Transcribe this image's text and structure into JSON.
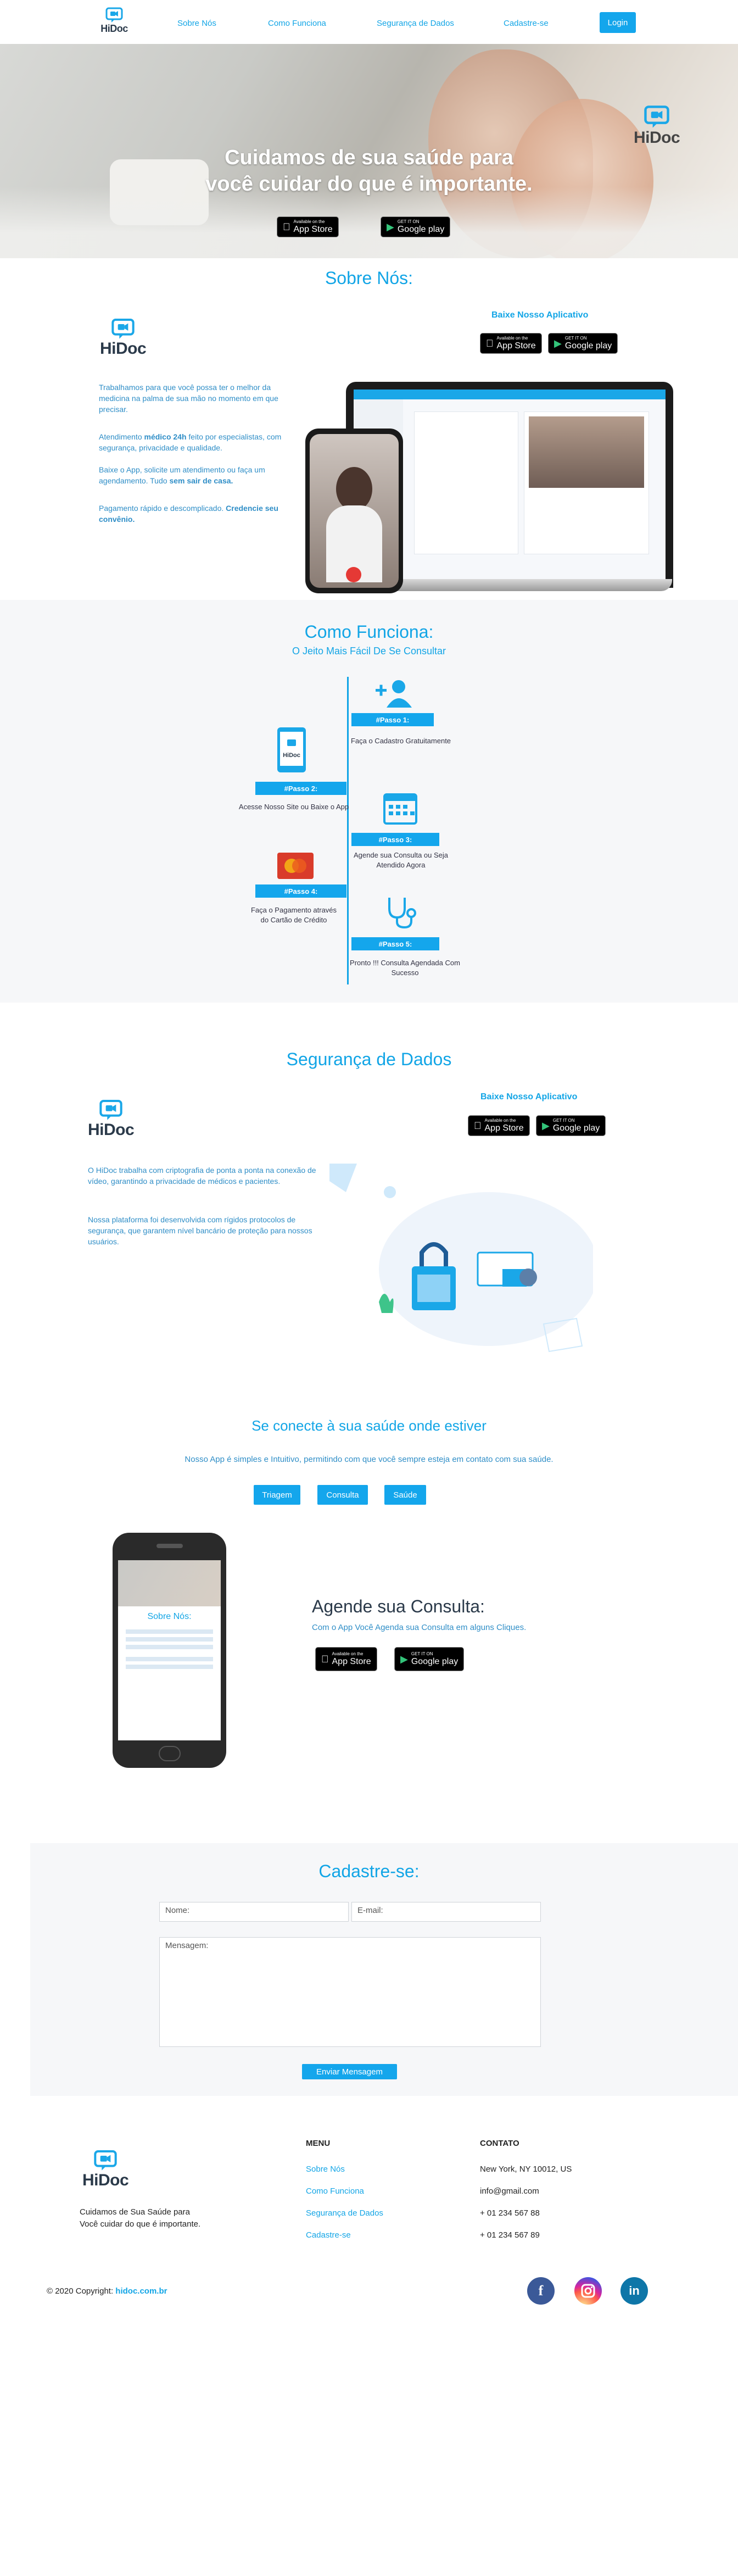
{
  "nav": {
    "logo": "HiDoc",
    "links": [
      "Sobre Nós",
      "Como Funciona",
      "Segurança de Dados",
      "Cadastre-se"
    ],
    "login": "Login"
  },
  "hero": {
    "title_line1": "Cuidamos de sua saúde para",
    "title_line2": "você cuidar do que é importante.",
    "logo": "HiDoc",
    "appstore_small": "Available on the",
    "appstore_big": "App Store",
    "googleplay_small": "GET IT ON",
    "googleplay_big": "Google play"
  },
  "sobre": {
    "title": "Sobre Nós:",
    "download_title": "Baixe Nosso Aplicativo",
    "logo": "HiDoc",
    "p1": "Trabalhamos para que você possa ter o melhor da medicina na palma de sua mão no momento em que precisar.",
    "p2_pre": "Atendimento ",
    "p2_bold": "médico 24h",
    "p2_post": " feito por especialistas, com segurança, privacidade e qualidade.",
    "p3_pre": "Baixe o App, solicite um atendimento ou faça um agendamento. Tudo ",
    "p3_bold": "sem sair de casa.",
    "p4_pre": "Pagamento rápido e descomplicado. ",
    "p4_bold": "Credencie seu convênio."
  },
  "como": {
    "title": "Como Funciona:",
    "subtitle": "O Jeito Mais Fácil De Se Consultar",
    "steps": [
      {
        "label": "#Passo 1:",
        "text": "Faça o Cadastro Gratuitamente",
        "icon": "add-user-icon"
      },
      {
        "label": "#Passo 2:",
        "text": "Acesse Nosso Site ou Baixe o App",
        "icon": "smartphone-icon"
      },
      {
        "label": "#Passo 3:",
        "text": "Agende sua Consulta ou Seja Atendido Agora",
        "icon": "calendar-icon"
      },
      {
        "label": "#Passo 4:",
        "text": "Faça o Pagamento através do Cartão de Crédito",
        "icon": "credit-card-icon"
      },
      {
        "label": "#Passo 5:",
        "text": "Pronto !!! Consulta Agendada Com Sucesso",
        "icon": "stethoscope-icon"
      }
    ]
  },
  "seguranca": {
    "title": "Segurança de Dados",
    "download_title": "Baixe Nosso Aplicativo",
    "logo": "HiDoc",
    "p1": "O HiDoc trabalha com criptografia de ponta a ponta na conexão de vídeo, garantindo a privacidade de médicos e pacientes.",
    "p2": "Nossa plataforma foi desenvolvida com rígidos protocolos de segurança, que garantem nível bancário de proteção para nossos usuários."
  },
  "conecte": {
    "title": "Se conecte à sua saúde onde estiver",
    "subtitle": "Nosso App é simples e Intuitivo, permitindo com que você sempre esteja em contato com sua saúde.",
    "tabs": [
      "Triagem",
      "Consulta",
      "Saúde"
    ],
    "agende_title": "Agende sua Consulta:",
    "agende_text": "Com o App Você Agenda sua Consulta em alguns Cliques.",
    "phone_title": "Sobre Nós:"
  },
  "cadastro": {
    "title": "Cadastre-se:",
    "name_placeholder": "Nome:",
    "email_placeholder": "E-mail:",
    "message_placeholder": "Mensagem:",
    "send": "Enviar Mensagem"
  },
  "footer": {
    "logo": "HiDoc",
    "tagline1": "Cuidamos de Sua Saúde para",
    "tagline2": "Você cuidar do que é importante.",
    "menu_title": "MENU",
    "menu": [
      "Sobre Nós",
      "Como Funciona",
      "Segurança de Dados",
      "Cadastre-se"
    ],
    "contact_title": "CONTATO",
    "contact": [
      "New York, NY 10012, US",
      "info@gmail.com",
      "+ 01 234 567 88",
      "+ 01 234 567 89"
    ],
    "copyright_pre": "© 2020 Copyright: ",
    "copyright_site": "hidoc.com.br"
  },
  "colors": {
    "accent": "#12a5e6",
    "button": "#14a6ec",
    "facebook": "#3b5998",
    "linkedin": "#0e76a8"
  }
}
